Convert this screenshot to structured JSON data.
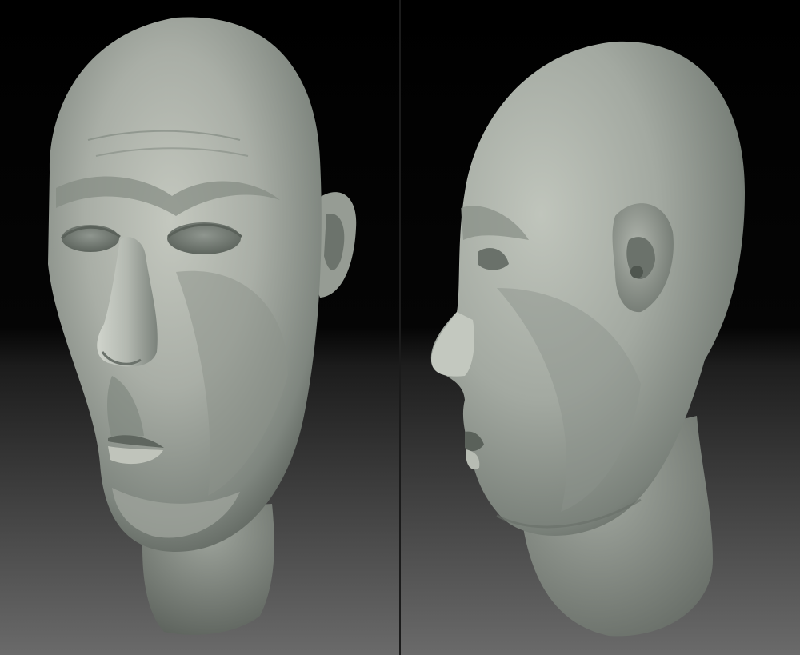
{
  "scene": {
    "views": [
      {
        "id": "front-three-quarter",
        "subject": "head-sculpt"
      },
      {
        "id": "side-profile",
        "subject": "head-sculpt"
      }
    ]
  },
  "colors": {
    "background_top": "#000000",
    "background_bottom": "#6a6a6a",
    "clay_light": "#b9bdb4",
    "clay_mid": "#8f968d",
    "clay_dark": "#4f554f"
  }
}
